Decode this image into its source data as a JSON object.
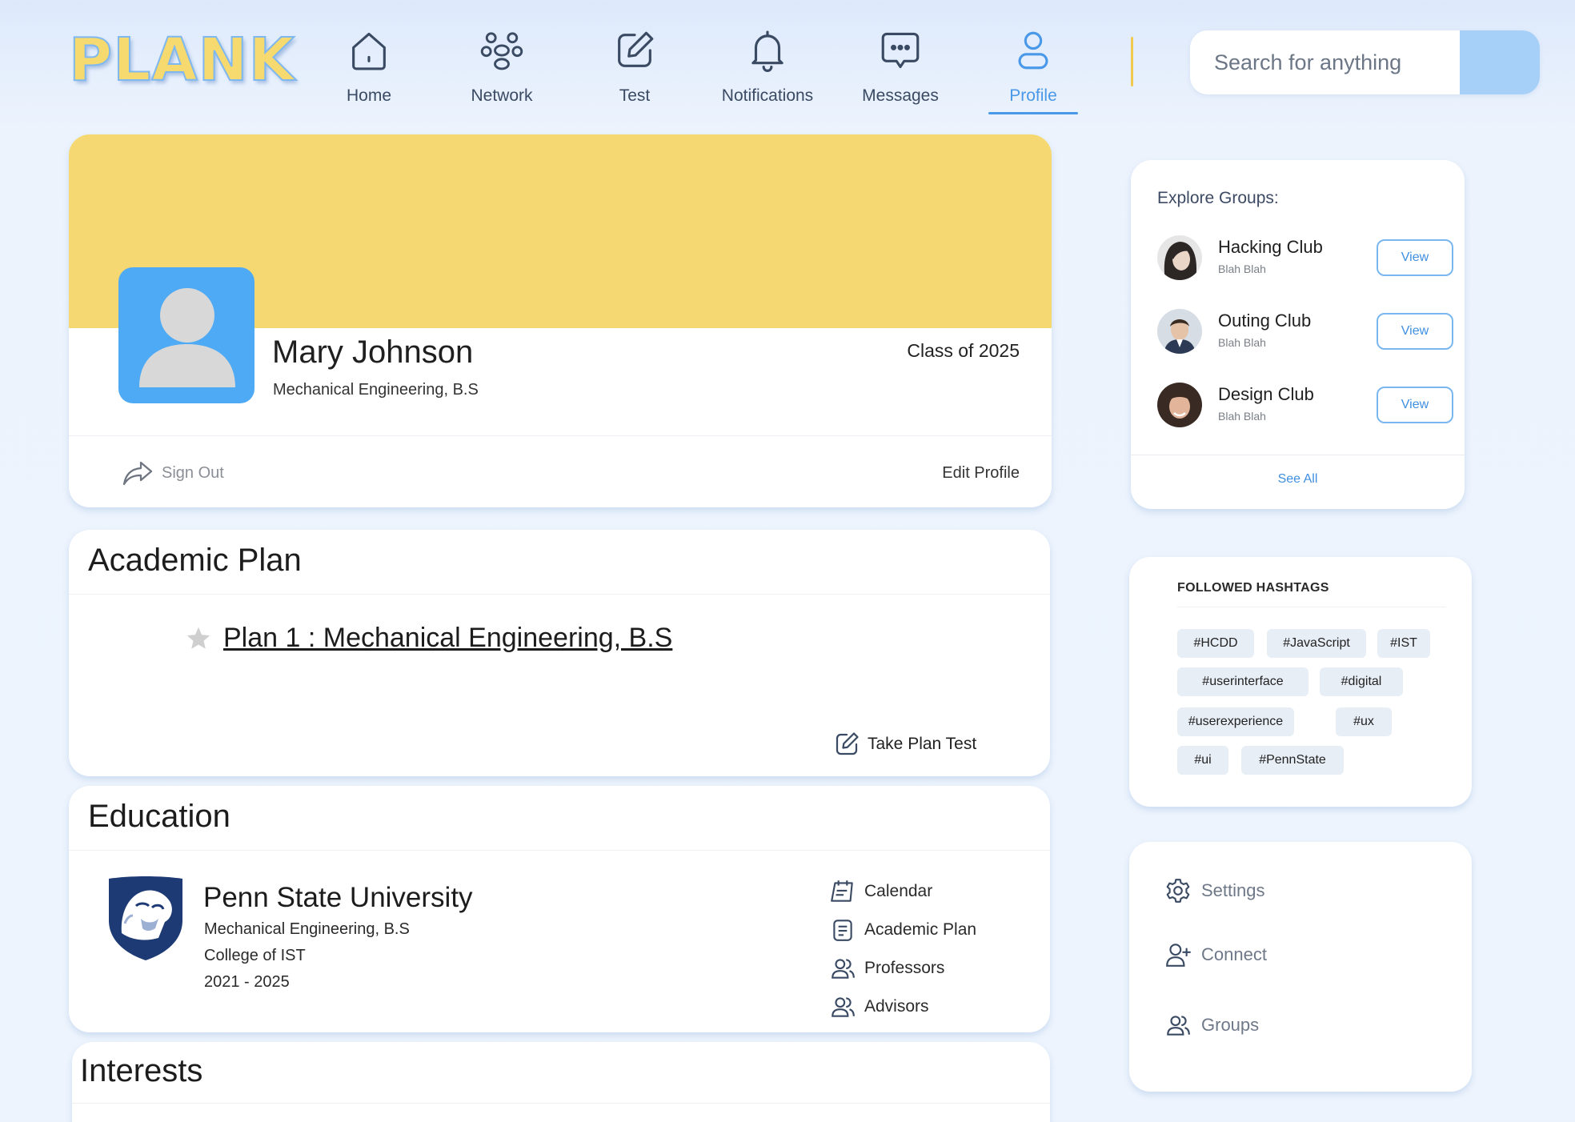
{
  "app": {
    "logo": "PLANK"
  },
  "nav": {
    "items": [
      {
        "label": "Home",
        "icon": "home-icon"
      },
      {
        "label": "Network",
        "icon": "network-icon"
      },
      {
        "label": "Test",
        "icon": "edit-icon"
      },
      {
        "label": "Notifications",
        "icon": "bell-icon"
      },
      {
        "label": "Messages",
        "icon": "chat-icon"
      },
      {
        "label": "Profile",
        "icon": "user-icon"
      }
    ],
    "active": "Profile"
  },
  "search": {
    "placeholder": "Search for anything"
  },
  "profile": {
    "name": "Mary Johnson",
    "major": "Mechanical Engineering, B.S",
    "class_year": "Class of 2025",
    "sign_out": "Sign Out",
    "edit_profile": "Edit Profile"
  },
  "academic_plan": {
    "title": "Academic Plan",
    "plan_link": "Plan 1 : Mechanical Engineering, B.S",
    "take_test": "Take Plan Test"
  },
  "education": {
    "title": "Education",
    "school": "Penn State University",
    "degree": "Mechanical Engineering, B.S",
    "college": "College of IST",
    "years": "2021 - 2025",
    "links": [
      "Calendar",
      "Academic Plan",
      "Professors",
      "Advisors"
    ]
  },
  "interests": {
    "title": "Interests"
  },
  "groups": {
    "title": "Explore Groups:",
    "items": [
      {
        "name": "Hacking Club",
        "sub": "Blah Blah",
        "button": "View"
      },
      {
        "name": "Outing Club",
        "sub": "Blah Blah",
        "button": "View"
      },
      {
        "name": "Design Club",
        "sub": "Blah Blah",
        "button": "View"
      }
    ],
    "see_all": "See All"
  },
  "hashtags": {
    "title": "FOLLOWED HASHTAGS",
    "tags": [
      "#HCDD",
      "#JavaScript",
      "#IST",
      "#userinterface",
      "#digital",
      "#userexperience",
      "#ux",
      "#ui",
      "#PennState"
    ]
  },
  "side_menu": {
    "items": [
      {
        "label": "Settings",
        "icon": "gear-icon"
      },
      {
        "label": "Connect",
        "icon": "add-user-icon"
      },
      {
        "label": "Groups",
        "icon": "users-icon"
      }
    ]
  },
  "colors": {
    "accent": "#4a98e8",
    "cover": "#f5d872",
    "avatar_bg": "#4eaaf4",
    "search_button": "#a6d0f7",
    "divider": "#f1c94c"
  }
}
